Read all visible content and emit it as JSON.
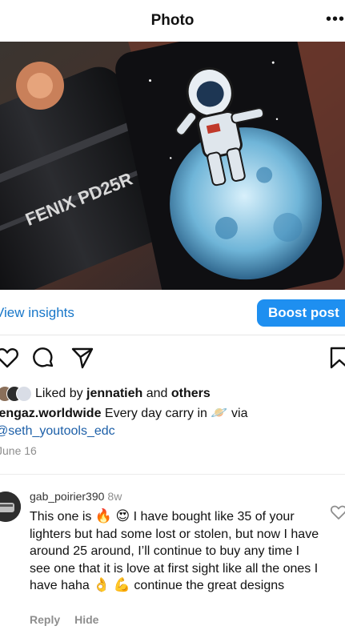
{
  "header": {
    "title": "Photo",
    "more_icon": "more-horizontal-icon",
    "more_glyph": "•••"
  },
  "photo": {
    "brand_text": "FENIX PD25R",
    "description_icon": "post-photo"
  },
  "insights": {
    "link_label": "View insights",
    "boost_label": "Boost post"
  },
  "actions": {
    "icons": [
      "heart-icon",
      "comment-icon",
      "share-icon",
      "bookmark-icon"
    ]
  },
  "likes": {
    "prefix": "Liked by ",
    "user": "jennatieh",
    "middle": " and ",
    "others": "others"
  },
  "caption": {
    "username": "lengaz.worldwide",
    "text": " Every day carry in ",
    "emoji": "🪐",
    "via": " via",
    "mention": "@seth_youtools_edc"
  },
  "date": "June 16",
  "comment": {
    "username": "gab_poirier390",
    "time": "8w",
    "part1": "This one is ",
    "emoji1": "🔥",
    "emoji2": "😍",
    "part2": " I have bought like 35 of your lighters but had some lost or stolen, but now I have around 25 around, I’ll continue to buy any time I see one that it is love at first sight like all the ones I have haha ",
    "emoji3": "👌",
    "emoji4": "💪",
    "part3": " continue the great designs",
    "reply_label": "Reply",
    "hide_label": "Hide"
  },
  "colors": {
    "link": "#1877c9",
    "boost_bg": "#1e8ff0",
    "meta": "#8e8e8e"
  }
}
